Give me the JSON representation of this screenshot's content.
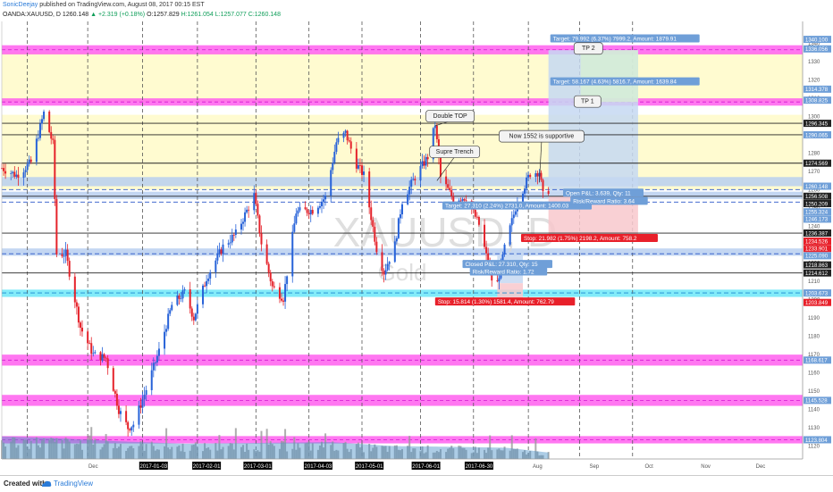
{
  "header": {
    "author": "SonicDeejay",
    "published": "published on TradingView.com, August 08, 2017 00:15 EST",
    "symbol": "OANDA:XAUUSD, D",
    "last": "1260.148",
    "change": "▲ +2.319 (+0.18%)",
    "open": "O:1257.829",
    "high": "H:1261.054",
    "low": "L:1257.077",
    "close": "C:1260.148"
  },
  "footer": {
    "created_with": "Created with",
    "brand": "TradingView"
  },
  "watermark": {
    "symbol": "XAUUSD, D",
    "name": "Gold"
  },
  "colors": {
    "up": "#2762d8",
    "down": "#e5232b",
    "magenta": "#ff55ee",
    "cyan": "#63e6f7",
    "yellow": "#fffbd0",
    "blue_band": "#b9cff0",
    "target_fill": "#c5d8f2",
    "stop_fill": "#f8c8cc",
    "tp_green": "#d9f2d0",
    "label_blue": "#6f9fd8",
    "label_red": "#e8202a"
  },
  "chart_data": {
    "type": "candlestick",
    "symbol": "OANDA:XAUUSD",
    "interval": "D",
    "ylim": [
      1113,
      1352
    ],
    "y_ticks": [
      1120,
      1130,
      1140,
      1150,
      1160,
      1170,
      1180,
      1190,
      1200,
      1210,
      1220,
      1230,
      1240,
      1250,
      1260,
      1270,
      1280,
      1290,
      1300,
      1310,
      1320,
      1330,
      1340
    ],
    "x_labels": [
      {
        "label": "Dec",
        "date": "2016-12-01",
        "highlight": false
      },
      {
        "label": "2017-01-03",
        "date": "2017-01-03",
        "highlight": true
      },
      {
        "label": "2017-02-01",
        "date": "2017-02-01",
        "highlight": true
      },
      {
        "label": "2017-03-01",
        "date": "2017-03-01",
        "highlight": true
      },
      {
        "label": "2017-04-03",
        "date": "2017-04-03",
        "highlight": true
      },
      {
        "label": "2017-05-01",
        "date": "2017-05-01",
        "highlight": true
      },
      {
        "label": "2017-06-01",
        "date": "2017-06-01",
        "highlight": true
      },
      {
        "label": "2017-06-30",
        "date": "2017-06-30",
        "highlight": true
      },
      {
        "label": "Aug",
        "date": "2017-08-01",
        "highlight": false
      },
      {
        "label": "Sep",
        "date": "2017-09-01",
        "highlight": false
      },
      {
        "label": "Oct",
        "date": "2017-10-01",
        "highlight": false
      },
      {
        "label": "Nov",
        "date": "2017-11-01",
        "highlight": false
      },
      {
        "label": "Dec",
        "date": "2017-12-01",
        "highlight": false
      }
    ],
    "vlines": [
      "2016-10-26",
      "2016-11-28",
      "2016-12-28",
      "2017-01-27",
      "2017-02-28",
      "2017-03-29",
      "2017-04-27",
      "2017-05-29",
      "2017-06-27",
      "2017-07-27",
      "2017-08-24",
      "2017-09-22"
    ],
    "x_start": "2016-10-12",
    "x_end": "2017-12-24",
    "last_date": "2017-08-07",
    "price_path": [
      [
        "2016-10-12",
        1272
      ],
      [
        "2016-10-20",
        1268
      ],
      [
        "2016-10-28",
        1275
      ],
      [
        "2016-11-04",
        1302
      ],
      [
        "2016-11-09",
        1285
      ],
      [
        "2016-11-11",
        1225
      ],
      [
        "2016-11-16",
        1225
      ],
      [
        "2016-11-24",
        1185
      ],
      [
        "2016-12-01",
        1170
      ],
      [
        "2016-12-08",
        1168
      ],
      [
        "2016-12-15",
        1140
      ],
      [
        "2016-12-20",
        1130
      ],
      [
        "2016-12-23",
        1132
      ],
      [
        "2016-12-30",
        1151
      ],
      [
        "2017-01-06",
        1172
      ],
      [
        "2017-01-13",
        1197
      ],
      [
        "2017-01-20",
        1204
      ],
      [
        "2017-01-25",
        1190
      ],
      [
        "2017-02-01",
        1212
      ],
      [
        "2017-02-10",
        1229
      ],
      [
        "2017-02-17",
        1236
      ],
      [
        "2017-02-27",
        1257
      ],
      [
        "2017-03-03",
        1231
      ],
      [
        "2017-03-09",
        1207
      ],
      [
        "2017-03-15",
        1201
      ],
      [
        "2017-03-22",
        1248
      ],
      [
        "2017-03-31",
        1249
      ],
      [
        "2017-04-07",
        1256
      ],
      [
        "2017-04-13",
        1286
      ],
      [
        "2017-04-18",
        1291
      ],
      [
        "2017-04-24",
        1274
      ],
      [
        "2017-04-28",
        1268
      ],
      [
        "2017-05-05",
        1228
      ],
      [
        "2017-05-09",
        1215
      ],
      [
        "2017-05-15",
        1230
      ],
      [
        "2017-05-19",
        1254
      ],
      [
        "2017-05-26",
        1267
      ],
      [
        "2017-06-02",
        1278
      ],
      [
        "2017-06-06",
        1296
      ],
      [
        "2017-06-09",
        1267
      ],
      [
        "2017-06-16",
        1255
      ],
      [
        "2017-06-23",
        1256
      ],
      [
        "2017-06-30",
        1241
      ],
      [
        "2017-07-07",
        1211
      ],
      [
        "2017-07-10",
        1209
      ],
      [
        "2017-07-14",
        1228
      ],
      [
        "2017-07-21",
        1254
      ],
      [
        "2017-07-28",
        1269
      ],
      [
        "2017-08-02",
        1270
      ],
      [
        "2017-08-04",
        1257
      ],
      [
        "2017-08-07",
        1260
      ]
    ],
    "volume_path": [
      [
        "2016-10-12",
        28
      ],
      [
        "2016-11-10",
        26
      ],
      [
        "2016-12-15",
        22
      ],
      [
        "2017-01-20",
        19
      ],
      [
        "2017-03-01",
        20
      ],
      [
        "2017-04-10",
        21
      ],
      [
        "2017-05-15",
        16
      ],
      [
        "2017-06-20",
        15
      ],
      [
        "2017-07-15",
        14
      ],
      [
        "2017-08-07",
        8
      ]
    ],
    "zones": [
      {
        "name": "yellow-zone-upper",
        "from": 1308,
        "to": 1335,
        "kind": "yellow"
      },
      {
        "name": "yellow-zone-lower",
        "from": 1260,
        "to": 1301,
        "kind": "yellow"
      },
      {
        "name": "blue-zone-a",
        "from": 1262,
        "to": 1267,
        "kind": "blue"
      },
      {
        "name": "blue-zone-b",
        "from": 1255,
        "to": 1259,
        "kind": "blue"
      },
      {
        "name": "blue-zone-c",
        "from": 1224,
        "to": 1228,
        "kind": "blue"
      },
      {
        "name": "magenta-zone-top",
        "from": 1334,
        "to": 1339,
        "kind": "magenta"
      },
      {
        "name": "magenta-zone-tp1",
        "from": 1306,
        "to": 1310,
        "kind": "magenta"
      },
      {
        "name": "cyan-zone",
        "from": 1201.5,
        "to": 1205.5,
        "kind": "cyan"
      },
      {
        "name": "magenta-zone-1166",
        "from": 1164,
        "to": 1170,
        "kind": "magenta"
      },
      {
        "name": "magenta-zone-1145",
        "from": 1142,
        "to": 1148,
        "kind": "magenta"
      },
      {
        "name": "magenta-zone-1123",
        "from": 1121.5,
        "to": 1125.5,
        "kind": "magenta"
      }
    ],
    "hlines": [
      {
        "price": 1296.345,
        "color": "#222222",
        "dash": false
      },
      {
        "price": 1290.065,
        "color": "#222222",
        "dash": false
      },
      {
        "price": 1274.569,
        "color": "#222222",
        "dash": false
      },
      {
        "price": 1260.148,
        "color": "#2a57c9",
        "dash": true
      },
      {
        "price": 1256.508,
        "color": "#222222",
        "dash": false
      },
      {
        "price": 1253.324,
        "color": "#2a57c9",
        "dash": true
      },
      {
        "price": 1236.387,
        "color": "#222222",
        "dash": false
      },
      {
        "price": 1225.09,
        "color": "#2a57c9",
        "dash": true
      },
      {
        "price": 1214.612,
        "color": "#222222",
        "dash": false
      },
      {
        "price": 1203.673,
        "color": "#1e8bd1",
        "dash": true
      }
    ],
    "price_labels": [
      {
        "text": "1340.100",
        "price": 1342.2,
        "style": "blue"
      },
      {
        "text": "1336.056",
        "price": 1337.0,
        "style": "blue"
      },
      {
        "text": "1314.378",
        "price": 1315.0,
        "style": "blue"
      },
      {
        "text": "1308.825",
        "price": 1309.0,
        "style": "blue"
      },
      {
        "text": "1296.345",
        "price": 1296.345,
        "style": "dark"
      },
      {
        "text": "1290.065",
        "price": 1290.065,
        "style": "blue"
      },
      {
        "text": "1274.569",
        "price": 1274.569,
        "style": "dark"
      },
      {
        "text": "1260.148",
        "price": 1262.0,
        "style": "blue"
      },
      {
        "text": "1256.508",
        "price": 1256.508,
        "style": "dark"
      },
      {
        "text": "1250.209",
        "price": 1252.5,
        "style": "dark"
      },
      {
        "text": "1255.324",
        "price": 1248.0,
        "style": "blue"
      },
      {
        "text": "1246.173",
        "price": 1244.0,
        "style": "blue"
      },
      {
        "text": "1236.387",
        "price": 1236.387,
        "style": "dark"
      },
      {
        "text": "1234.526",
        "price": 1232.0,
        "style": "red"
      },
      {
        "text": "1233.901",
        "price": 1228.0,
        "style": "red"
      },
      {
        "text": "1225.090",
        "price": 1224.0,
        "style": "blue"
      },
      {
        "text": "1218.863",
        "price": 1219.0,
        "style": "dark"
      },
      {
        "text": "1214.612",
        "price": 1214.612,
        "style": "dark"
      },
      {
        "text": "1203.673",
        "price": 1203.673,
        "style": "blue"
      },
      {
        "text": "1203.849",
        "price": 1198.5,
        "style": "red"
      },
      {
        "text": "1168.617",
        "price": 1167.0,
        "style": "blue"
      },
      {
        "text": "1145.528",
        "price": 1145.0,
        "style": "blue"
      },
      {
        "text": "1123.804",
        "price": 1123.5,
        "style": "blue"
      }
    ],
    "positions": [
      {
        "name": "long-position-open",
        "start": "2017-08-07",
        "end": "2017-09-25",
        "entry": 1256.5,
        "stop": 1234.5,
        "target": 1336.3
      },
      {
        "name": "long-position-closed",
        "start": "2017-07-10",
        "end": "2017-07-24",
        "entry": 1209,
        "stop": 1201,
        "target": 1226
      }
    ],
    "labels": [
      {
        "name": "target-tp2-label",
        "text": "Target: 79.992 (6.37%) 7999.2, Amount: 1879.91",
        "style": "blue",
        "date": "2017-08-08",
        "price": 1342.5,
        "anchor": "start"
      },
      {
        "name": "target-tp1-label",
        "text": "Target: 58.167 (4.63%) 5816.7, Amount: 1639.84",
        "style": "blue",
        "date": "2017-08-08",
        "price": 1319.0,
        "anchor": "start"
      },
      {
        "name": "target-closed-label",
        "text": "Target: 27.310 (2.24%) 2731.0, Amount: 1400.03",
        "style": "blue",
        "date": "2017-06-10",
        "price": 1251.2,
        "anchor": "start"
      },
      {
        "name": "open-pnl-label",
        "text": "Open P&L: 3.639, Qty: 11",
        "style": "blue",
        "date": "2017-08-15",
        "price": 1258.2,
        "anchor": "start"
      },
      {
        "name": "risk-reward-open-label",
        "text": "Risk/Reward Ratio: 3.64",
        "style": "blue",
        "date": "2017-08-19",
        "price": 1253.8,
        "anchor": "start"
      },
      {
        "name": "stop-open-label",
        "text": "Stop: 21.982 (1.75%) 2198.2, Amount: 758.2",
        "style": "red",
        "date": "2017-07-23",
        "price": 1233.5,
        "anchor": "start"
      },
      {
        "name": "closed-pnl-label",
        "text": "Closed P&L: 27.310, Qty: 15",
        "style": "blue",
        "date": "2017-06-21",
        "price": 1219.3,
        "anchor": "start"
      },
      {
        "name": "risk-reward-closed-label",
        "text": "Risk/Reward Ratio: 1.72",
        "style": "blue",
        "date": "2017-06-25",
        "price": 1215.2,
        "anchor": "start"
      },
      {
        "name": "stop-closed-label",
        "text": "Stop: 15.814 (1.30%) 1581.4, Amount: 762.79",
        "style": "red",
        "date": "2017-06-06",
        "price": 1198.8,
        "anchor": "start"
      }
    ],
    "callouts": [
      {
        "name": "tp2-callout",
        "text": "TP 2",
        "date": "2017-08-21",
        "price": 1337.5,
        "w": 32,
        "tip": null
      },
      {
        "name": "tp1-callout",
        "text": "TP 1",
        "date": "2017-08-21",
        "price": 1308.5,
        "w": 30,
        "tip": null
      },
      {
        "name": "double-top-callout",
        "text": "Double TOP",
        "date": "2017-06-01",
        "price": 1300.5,
        "w": 54,
        "tip": [
          "2017-06-06",
          1295
        ]
      },
      {
        "name": "supre-trench-callout",
        "text": "Supre Trench",
        "date": "2017-06-03",
        "price": 1281.0,
        "w": 56,
        "tip": [
          "2017-06-07",
          1265
        ]
      },
      {
        "name": "now-supportive-callout",
        "text": "Now 1552 is supportive",
        "date": "2017-07-11",
        "price": 1289.5,
        "w": 95,
        "tip": [
          "2017-08-02",
          1264
        ]
      }
    ]
  }
}
